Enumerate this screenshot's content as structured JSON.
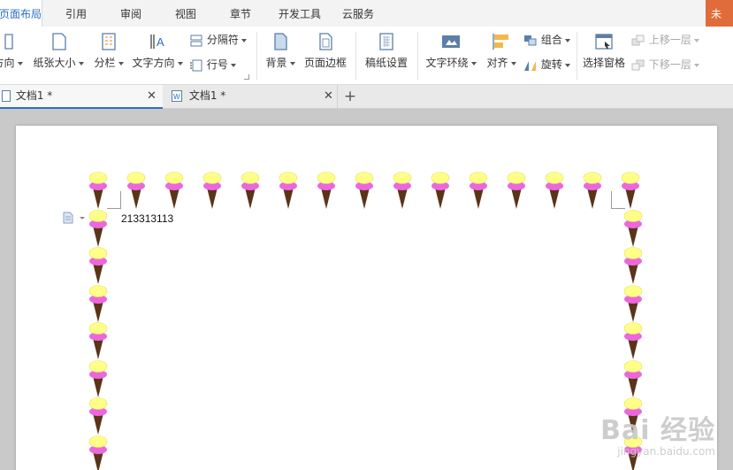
{
  "menu": {
    "tabs": [
      "页面布局",
      "引用",
      "审阅",
      "视图",
      "章节",
      "开发工具",
      "云服务"
    ],
    "active": "页面布局",
    "corner_label": "未"
  },
  "ribbon": {
    "orientation": "方向",
    "paper_size": "纸张大小",
    "columns": "分栏",
    "text_direction": "文字方向",
    "breaks": "分隔符",
    "line_numbers": "行号",
    "background": "背景",
    "page_border": "页面边框",
    "manuscript": "稿纸设置",
    "text_wrap": "文字环绕",
    "align": "对齐",
    "group": "组合",
    "rotate": "旋转",
    "selection_pane": "选择窗格",
    "bring_forward": "上移一层",
    "send_backward": "下移一层"
  },
  "doc_tabs": [
    {
      "title": "文档1 *",
      "active": true
    },
    {
      "title": "文档1 *",
      "active": false
    }
  ],
  "document": {
    "text": "213313113"
  },
  "watermark": {
    "brand": "Bai 经验",
    "url": "jingyan.baidu.com"
  },
  "colors": {
    "accent": "#2b6fc2",
    "corner": "#e06c3c",
    "cone_yellow": "#ffff88",
    "cone_pink": "#ee66dd",
    "cone_brown": "#5a3418"
  }
}
